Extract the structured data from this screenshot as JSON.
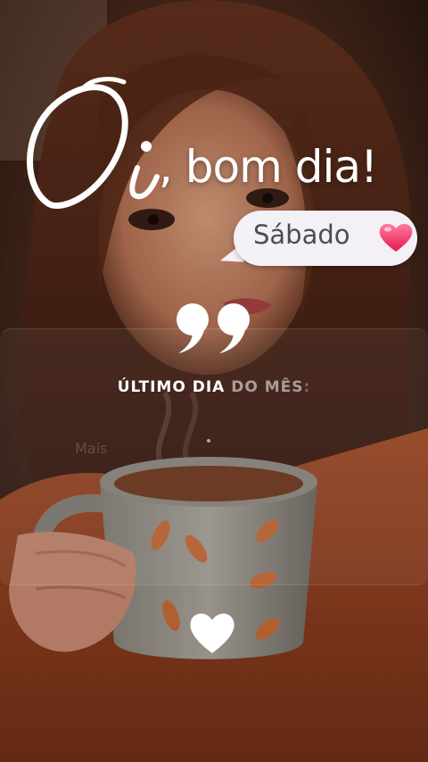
{
  "greeting": {
    "script_part": "Oi",
    "comma_rest": ", bom dia!"
  },
  "bubble": {
    "day": "Sábado"
  },
  "quote_block": {
    "line_strong": "ÚLTIMO DIA",
    "line_mid": " DO MÊS",
    "line_end": ":",
    "faint_text": "Mais"
  },
  "colors": {
    "bubble_bg": "#f4f1f6",
    "heart_pink": "#ff3d6e",
    "text_white": "#ffffff"
  },
  "icons": [
    "quote-icon",
    "heart-icon"
  ]
}
